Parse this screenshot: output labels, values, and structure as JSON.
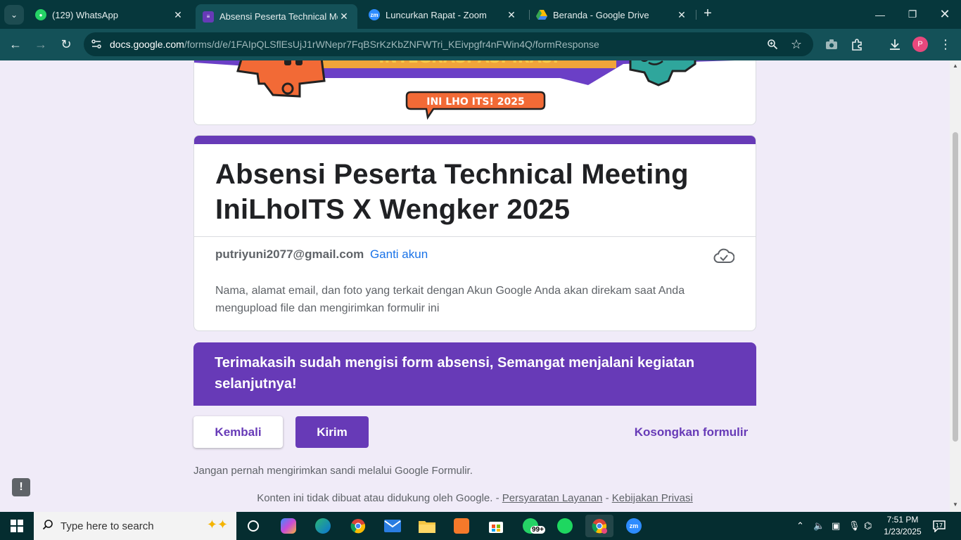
{
  "browser": {
    "tabs": [
      {
        "title": "(129) WhatsApp",
        "favicon": "whatsapp-icon",
        "color": "#25d366",
        "active": false
      },
      {
        "title": "Absensi Peserta Technical Meeti",
        "favicon": "google-forms-icon",
        "color": "#673ab7",
        "active": true
      },
      {
        "title": "Luncurkan Rapat - Zoom",
        "favicon": "zoom-icon",
        "color": "#2d8cff",
        "active": false
      },
      {
        "title": "Beranda - Google Drive",
        "favicon": "google-drive-icon",
        "color": "#fbbc04",
        "active": false
      }
    ],
    "whatsapp_badge": "99+",
    "zoom_badge": "zm",
    "url_host": "docs.google.com",
    "url_path": "/forms/d/e/1FAIpQLSflEsUjJ1rWNepr7FqBSrKzKbZNFWTri_KEivpgfr4nFWin4Q/formResponse",
    "profile_initial": "P"
  },
  "form": {
    "banner_text": "INI LHO ITS! 2025",
    "title": "Absensi Peserta Technical Meeting IniLhoITS X Wengker 2025",
    "account_email": "putriyuni2077@gmail.com",
    "switch_account": "Ganti akun",
    "notice": "Nama, alamat email, dan foto yang terkait dengan Akun Google Anda akan direkam saat Anda mengupload file dan mengirimkan formulir ini",
    "thanks": "Terimakasih sudah mengisi form absensi, Semangat menjalani kegiatan selanjutnya!",
    "back_label": "Kembali",
    "submit_label": "Kirim",
    "clear_label": "Kosongkan formulir",
    "password_warning": "Jangan pernah mengirimkan sandi melalui Google Formulir.",
    "footer_text": "Konten ini tidak dibuat atau didukung oleh Google. -",
    "footer_terms": "Persyaratan Layanan",
    "footer_sep": "-",
    "footer_privacy": "Kebijakan Privasi",
    "accent_color": "#673ab7"
  },
  "taskbar": {
    "search_placeholder": "Type here to search",
    "whatsapp_badge": "99+",
    "time": "7:51 PM",
    "date": "1/23/2025",
    "notification_count": "17"
  }
}
